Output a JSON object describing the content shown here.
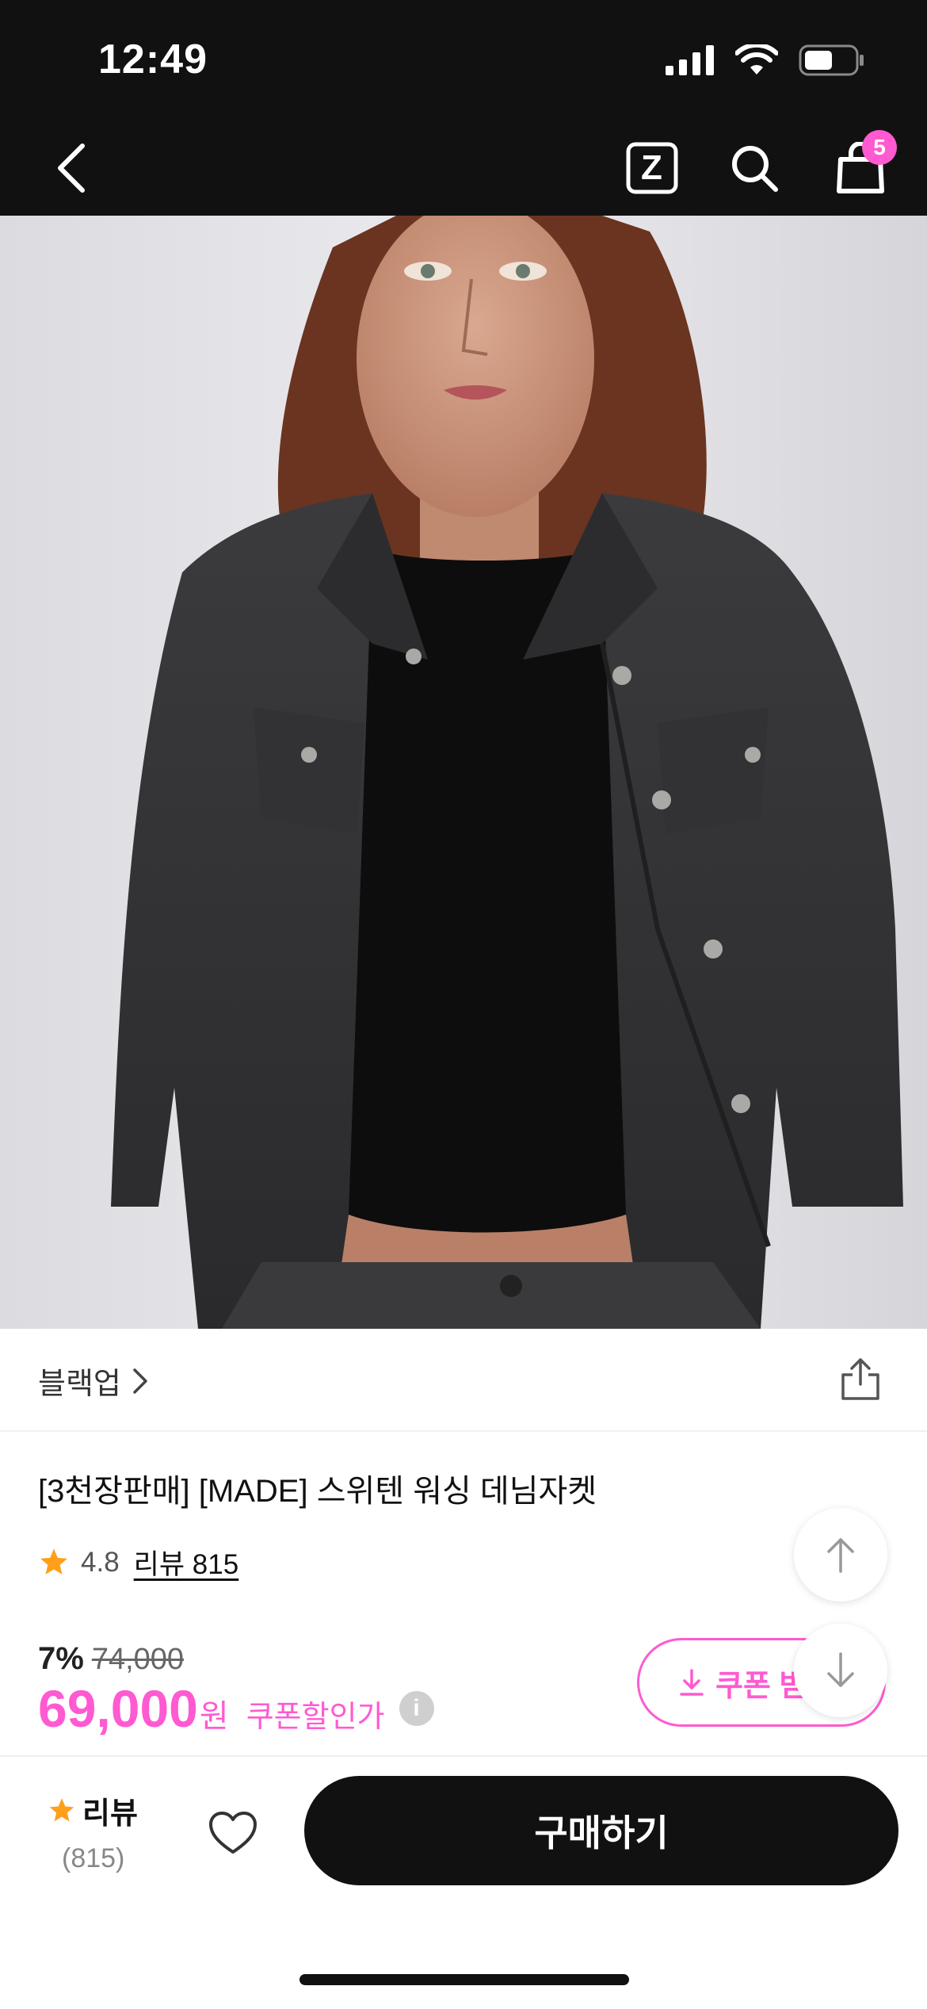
{
  "status_bar": {
    "time": "12:49"
  },
  "nav": {
    "cart_count": "5",
    "z_label": "Z"
  },
  "brand": {
    "name": "블랙업"
  },
  "product": {
    "title": "[3천장판매] [MADE] 스위텐 워싱 데님자켓",
    "rating": "4.8",
    "review_link": "리뷰 815",
    "discount_rate": "7%",
    "original_price": "74,000",
    "sale_price": "69,000",
    "currency": "원",
    "coupon_text": "쿠폰할인가",
    "coupon_button": "쿠폰 받",
    "info_glyph": "i"
  },
  "bottom_bar": {
    "review_label": "리뷰",
    "review_count": "(815)",
    "buy_label": "구매하기"
  },
  "colors": {
    "accent": "#ff5ad1",
    "dark": "#111111",
    "star": "#ff9f1a"
  }
}
